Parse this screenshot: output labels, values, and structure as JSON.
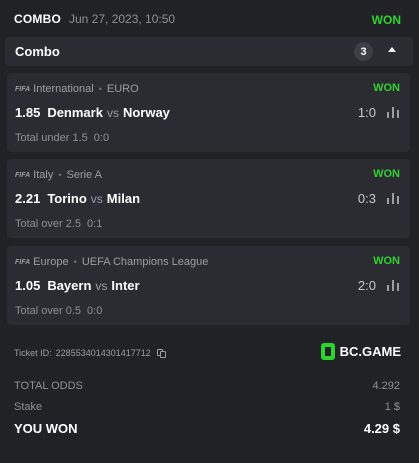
{
  "header": {
    "bet_type": "COMBO",
    "date": "Jun 27, 2023, 10:50",
    "status": "WON",
    "colors": {
      "won": "#2fd22f",
      "background": "#202226",
      "panel": "#2a2c31"
    }
  },
  "combo": {
    "label": "Combo",
    "count": "3",
    "toggle_icon": "caret-up-icon"
  },
  "bets": [
    {
      "provider_logo": "FIFA",
      "region": "International",
      "competition": "EURO",
      "status": "WON",
      "odds": "1.85",
      "home": "Denmark",
      "vs": "vs",
      "away": "Norway",
      "score": "1:0",
      "market": "Total under 1.5",
      "selection": "0:0",
      "stats_icon": "bar-chart-icon"
    },
    {
      "provider_logo": "FIFA",
      "region": "Italy",
      "competition": "Serie A",
      "status": "WON",
      "odds": "2.21",
      "home": "Torino",
      "vs": "vs",
      "away": "Milan",
      "score": "0:3",
      "market": "Total over 2.5",
      "selection": "0:1",
      "stats_icon": "bar-chart-icon"
    },
    {
      "provider_logo": "FIFA",
      "region": "Europe",
      "competition": "UEFA Champions League",
      "status": "WON",
      "odds": "1.05",
      "home": "Bayern",
      "vs": "vs",
      "away": "Inter",
      "score": "2:0",
      "market": "Total over 0.5",
      "selection": "0:0",
      "stats_icon": "bar-chart-icon"
    }
  ],
  "ticket": {
    "label": "Ticket ID:",
    "id": "2285534014301417712",
    "copy_icon": "copy-icon"
  },
  "brand": {
    "name": "BC.GAME",
    "logo_icon": "bc-game-logo-icon"
  },
  "summary": {
    "total_odds_label": "TOTAL ODDS",
    "total_odds": "4.292",
    "stake_label": "Stake",
    "stake": "1 $",
    "won_label": "YOU WON",
    "won": "4.29 $"
  }
}
